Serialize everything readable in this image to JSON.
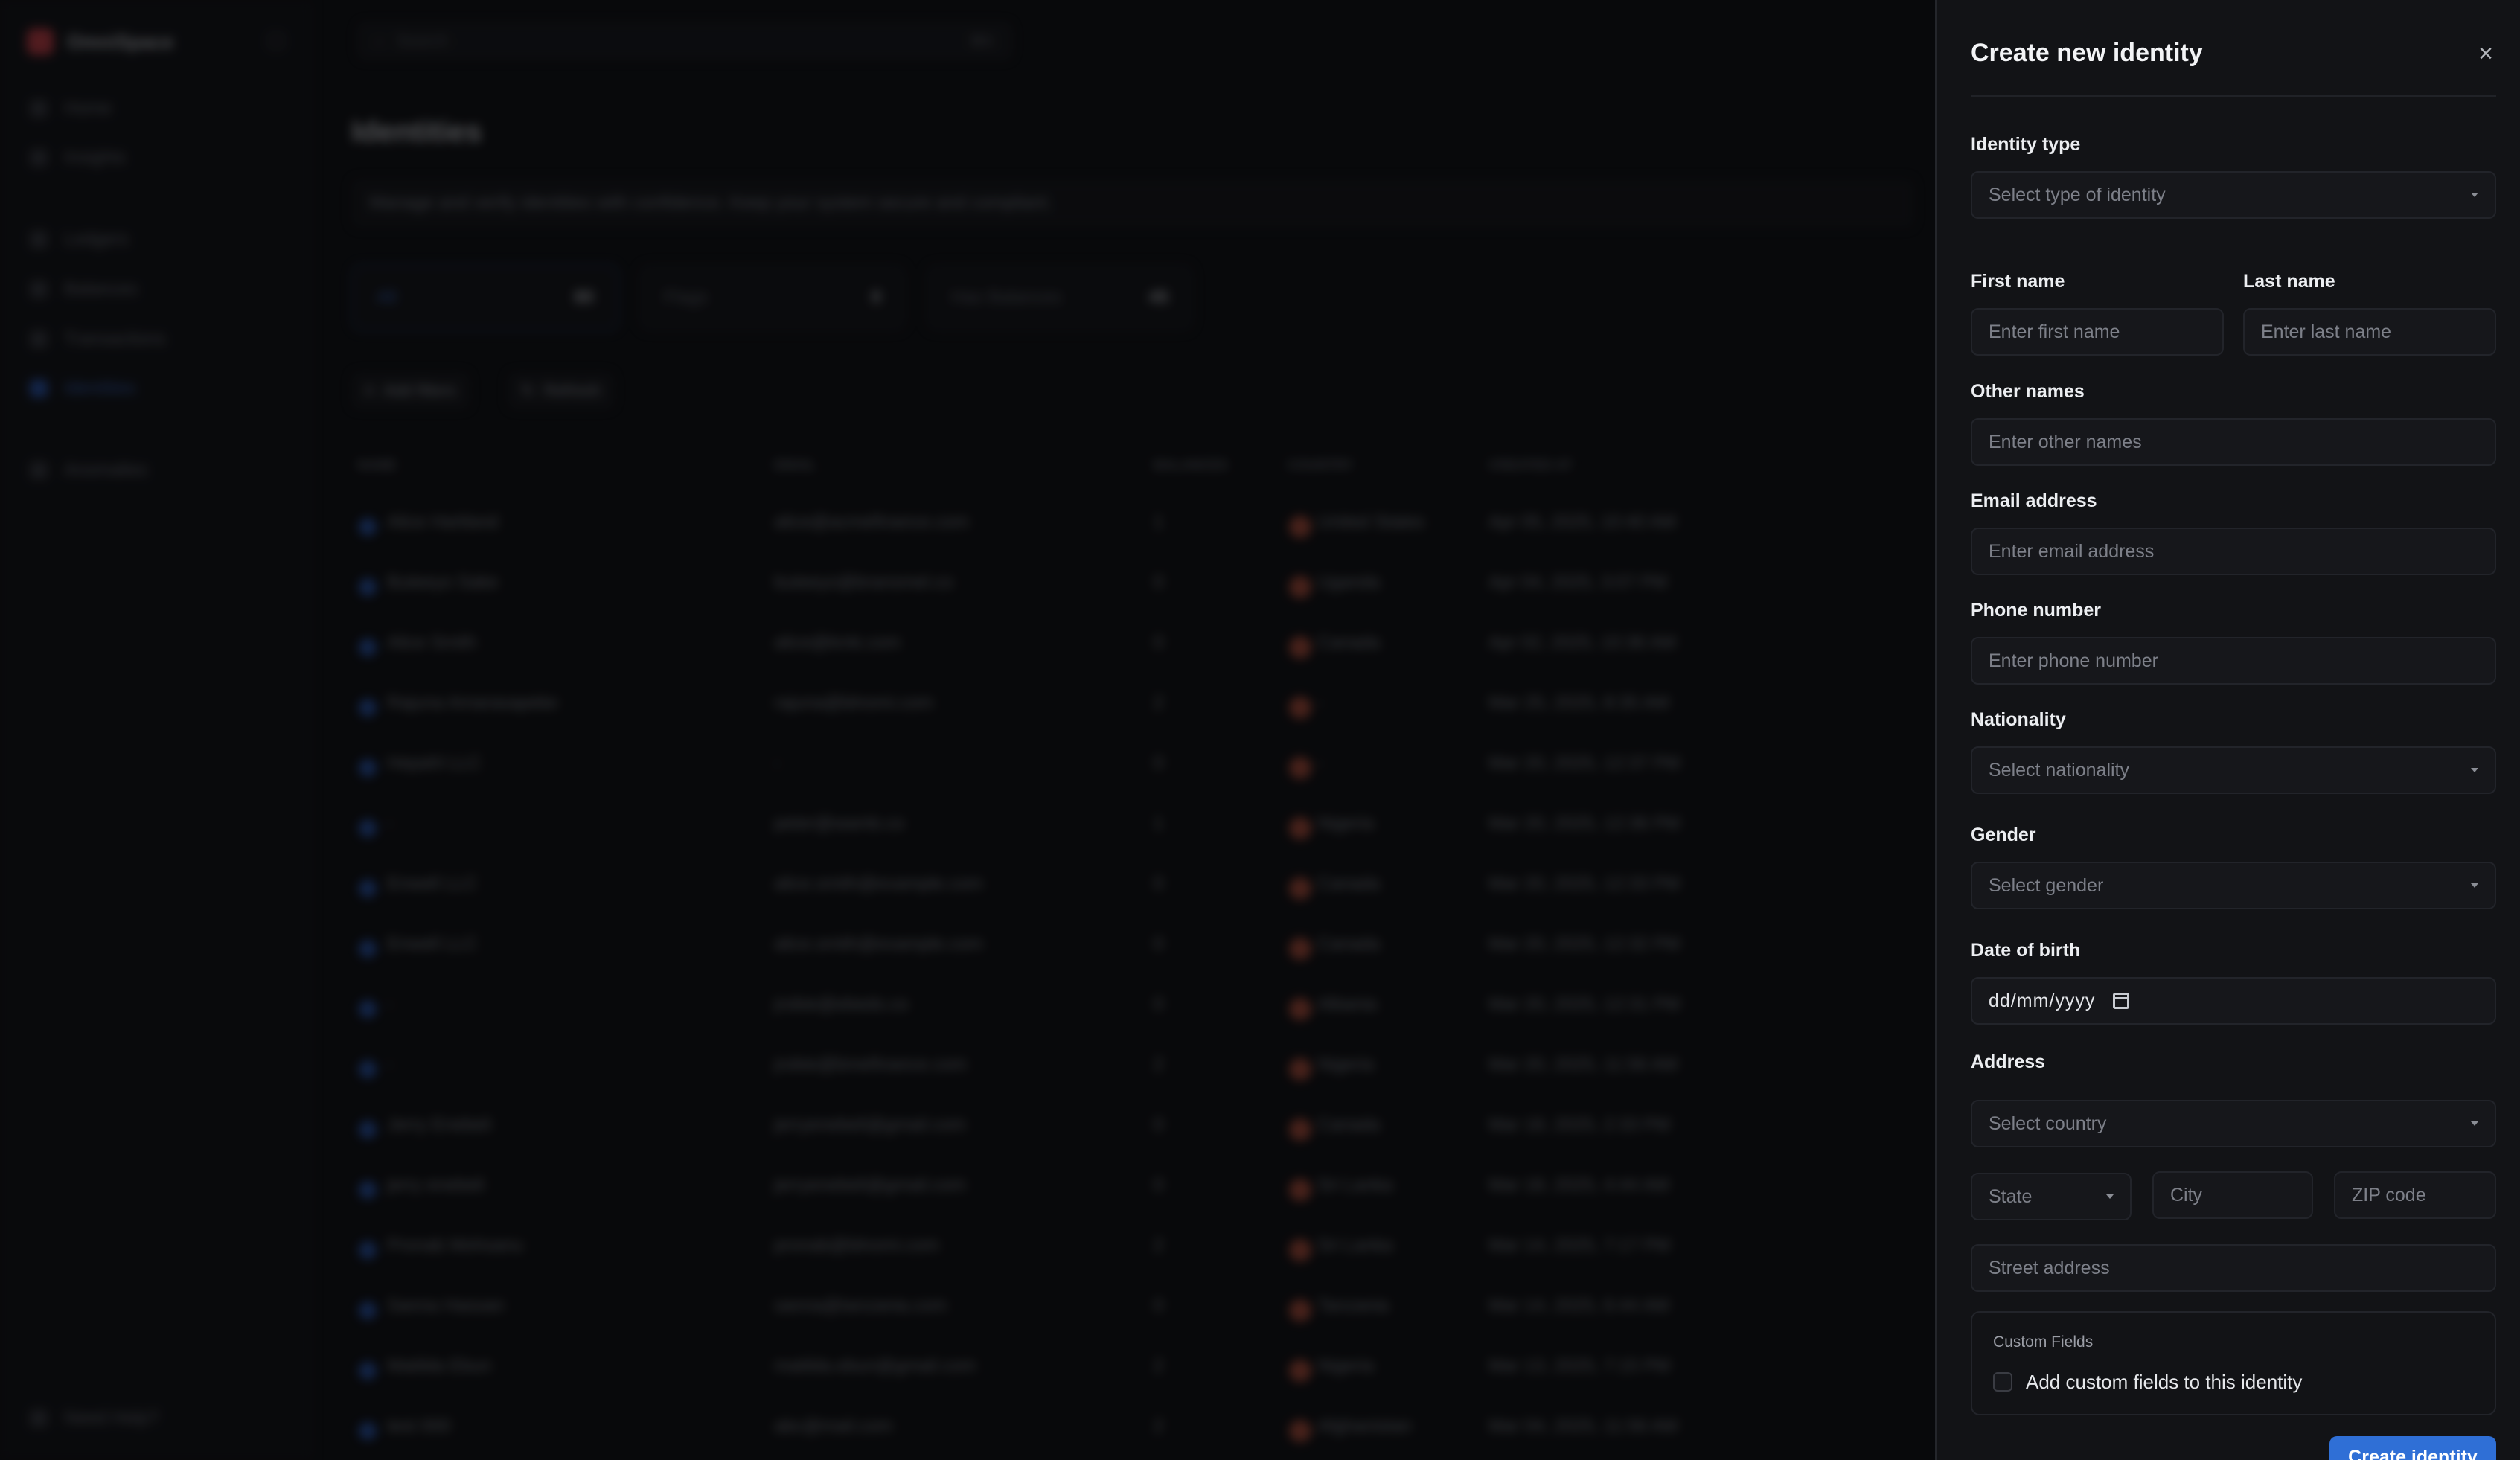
{
  "app": {
    "brand_name": "OmniSpace",
    "nav": [
      {
        "label": "Home"
      },
      {
        "label": "Insights"
      },
      {
        "label": "Ledgers"
      },
      {
        "label": "Balances"
      },
      {
        "label": "Transactions"
      },
      {
        "label": "Identities"
      },
      {
        "label": "Anomalies"
      }
    ],
    "help_label": "Need Help?",
    "search_placeholder": "Search",
    "search_shortcut": "⌘K",
    "page_title": "Identities",
    "page_description": "Manage and verify identities with confidence. Keep your system secure and compliant.",
    "stats": [
      {
        "label": "All",
        "value": "80"
      },
      {
        "label": "Flags",
        "value": "0"
      },
      {
        "label": "Has Balances",
        "value": "45"
      }
    ],
    "chips": [
      "Add filters",
      "Refresh"
    ],
    "table": {
      "columns": [
        "NAME",
        "EMAIL",
        "BALANCES",
        "COUNTRY",
        "CREATED AT"
      ],
      "rows": [
        [
          "Alice Hartland",
          "alice@acmefinance.com",
          "1",
          "United States",
          "Apr 05, 2025, 10:40 AM"
        ],
        [
          "Buteeyo Sake",
          "buteeyo@bransmel.co",
          "0",
          "Uganda",
          "Apr 04, 2025, 3:07 PM"
        ],
        [
          "Alice Smith",
          "alice@kmk.com",
          "0",
          "Canada",
          "Apr 02, 2025, 10:36 AM"
        ],
        [
          "Rajuna Amarasapeke",
          "rajuna@blnomi.com",
          "2",
          "-",
          "Mar 25, 2025, 8:35 AM"
        ],
        [
          "Hepahl LLC",
          "-",
          "0",
          "-",
          "Mar 20, 2025, 12:37 PM"
        ],
        [
          "-",
          "peter@wamb.co",
          "1",
          "Nigeria",
          "Mar 20, 2025, 12:36 PM"
        ],
        [
          "Enwell LLC",
          "alice.smith@example.com",
          "0",
          "Canada",
          "Mar 20, 2025, 12:33 PM"
        ],
        [
          "Enwell LLC",
          "alice.smith@example.com",
          "0",
          "Canada",
          "Mar 20, 2025, 12:32 PM"
        ],
        [
          "-",
          "jrobie@ebeds.co",
          "0",
          "Albania",
          "Mar 20, 2025, 12:31 PM"
        ],
        [
          "-",
          "jrobie@bmefinance.com",
          "2",
          "Nigeria",
          "Mar 20, 2025, 11:56 AM"
        ],
        [
          "Jerry Enebeli",
          "jerryenebeli@gmail.com",
          "0",
          "Canada",
          "Mar 18, 2025, 2:33 PM"
        ],
        [
          "jerry enebeli",
          "jerryenebeli@gmail.com",
          "0",
          "Sri Lanka",
          "Mar 18, 2025, 4:44 AM"
        ],
        [
          "Pronab Mohsanu",
          "pronab@blnomi.com",
          "2",
          "Sri Lanka",
          "Mar 14, 2025, 7:17 PM"
        ],
        [
          "Sanna Hassan",
          "sanna@tanzania.com",
          "0",
          "Tanzania",
          "Mar 14, 2025, 6:44 AM"
        ],
        [
          "Matilda Ebun",
          "matilda.ebun@gmail.com",
          "2",
          "Nigeria",
          "Mar 13, 2025, 7:15 PM"
        ],
        [
          "test 000",
          "abc@mail.com",
          "2",
          "Afghanistan",
          "Mar 04, 2025, 11:56 AM"
        ]
      ]
    }
  },
  "drawer": {
    "title": "Create new identity",
    "identity_type": {
      "label": "Identity type",
      "placeholder": "Select type of identity"
    },
    "first_name": {
      "label": "First name",
      "placeholder": "Enter first name"
    },
    "last_name": {
      "label": "Last name",
      "placeholder": "Enter last name"
    },
    "other_names": {
      "label": "Other names",
      "placeholder": "Enter other names"
    },
    "email": {
      "label": "Email address",
      "placeholder": "Enter email address"
    },
    "phone": {
      "label": "Phone number",
      "placeholder": "Enter phone number"
    },
    "nationality": {
      "label": "Nationality",
      "placeholder": "Select nationality"
    },
    "gender": {
      "label": "Gender",
      "placeholder": "Select gender"
    },
    "dob": {
      "label": "Date of birth",
      "placeholder": "dd/mm/yyyy"
    },
    "address": {
      "label": "Address",
      "country_placeholder": "Select country",
      "state_placeholder": "State",
      "city_placeholder": "City",
      "zip_placeholder": "ZIP code",
      "street_placeholder": "Street address"
    },
    "custom_fields": {
      "title": "Custom Fields",
      "checkbox_label": "Add custom fields to this identity"
    },
    "submit_label": "Create identity",
    "accent_color": "#2f6fd6"
  }
}
